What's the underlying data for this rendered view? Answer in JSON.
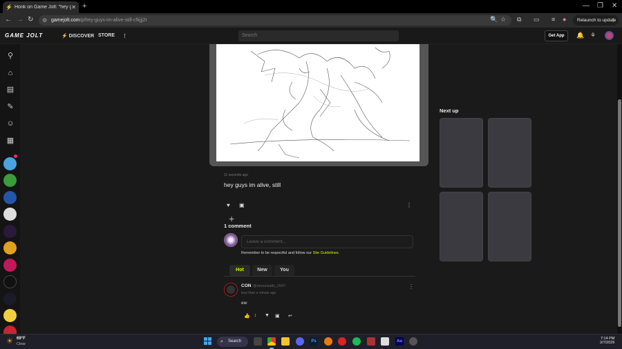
{
  "browser": {
    "tab_title": "Honk on Game Jolt: \"hey guys",
    "new_tab": "+",
    "url_host": "gamejolt.com",
    "url_path": "/p/hey-guys-im-alive-still-cfkjjj2r",
    "relaunch_label": "Relaunch to update"
  },
  "gamejolt": {
    "logo": "GAME JOLT",
    "nav": [
      {
        "label": "DISCOVER"
      },
      {
        "label": "STORE"
      }
    ],
    "search_placeholder": "Search",
    "get_app_label": "Get App"
  },
  "post": {
    "timestamp": "11 seconds ago",
    "text": "hey guys im alive, still",
    "comment_count": "1 comment",
    "comment_placeholder": "Leave a comment...",
    "guidelines_prefix": "Remember to be respectful and follow our ",
    "guidelines_link": "Site Guidelines",
    "guidelines_suffix": "."
  },
  "comment_tabs": [
    {
      "label": "Hot",
      "active": true
    },
    {
      "label": "New",
      "active": false
    },
    {
      "label": "You",
      "active": false
    }
  ],
  "comment": {
    "name": "CON",
    "handle": "@mmurwalls_2647",
    "time": "less than a minute ago",
    "body": "ew",
    "like_count": "1"
  },
  "sidebar_right": {
    "next_up_label": "Next up"
  },
  "taskbar": {
    "temperature": "69°F",
    "condition": "Clear",
    "search_label": "Search",
    "time": "7:14 PM",
    "date": "2/7/2026"
  },
  "colors": {
    "accent": "#ccff00",
    "pink": "#f3267f",
    "page_bg": "#1a1a1a"
  }
}
